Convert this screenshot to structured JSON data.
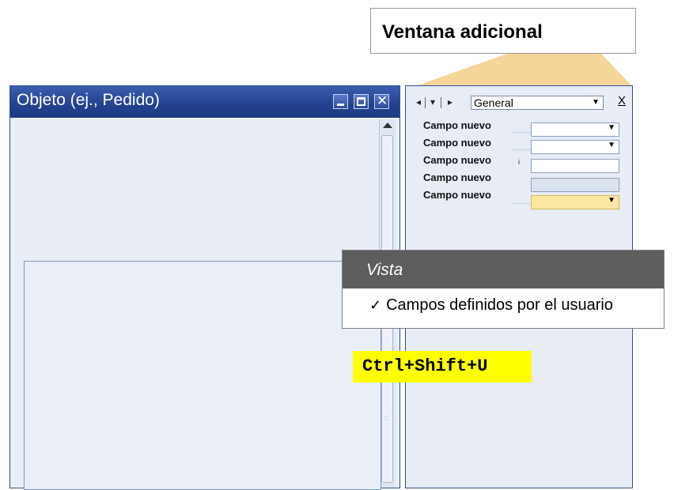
{
  "callout": {
    "label": "Ventana adicional",
    "beam_color": "#f5d69a"
  },
  "main_window": {
    "title": "Objeto (ej., Pedido)",
    "buttons": {
      "minimize": "minimize-icon",
      "maximize": "maximize-icon",
      "close": "close-icon"
    }
  },
  "additional_window": {
    "tab_selected": "General",
    "fields": [
      {
        "label": "Campo nuevo",
        "type": "dropdown"
      },
      {
        "label": "Campo nuevo",
        "type": "dropdown"
      },
      {
        "label": "Campo nuevo",
        "type": "text"
      },
      {
        "label": "Campo nuevo",
        "type": "disabled"
      },
      {
        "label": "Campo nuevo",
        "type": "dropdown-highlighted"
      }
    ],
    "close_label": "X"
  },
  "view_menu": {
    "title": "Vista",
    "item": "Campos definidos por el usuario",
    "checked": true
  },
  "shortcut": "Ctrl+Shift+U"
}
